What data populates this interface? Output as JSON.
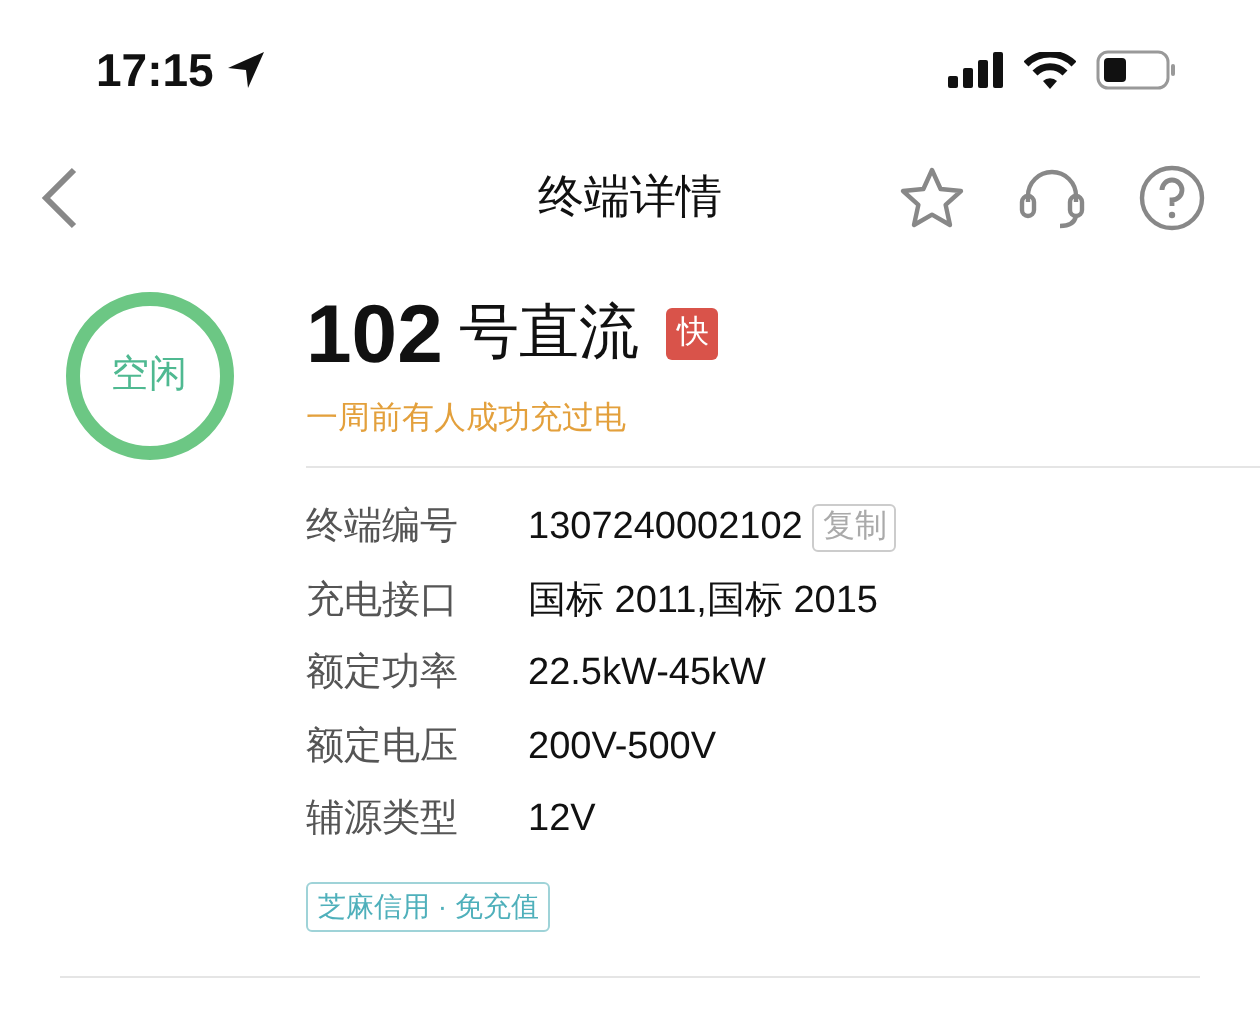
{
  "status_bar": {
    "time": "17:15"
  },
  "nav": {
    "title": "终端详情"
  },
  "terminal": {
    "status": "空闲",
    "number": "102",
    "type": "号直流",
    "badge": "快",
    "note": "一周前有人成功充过电",
    "fields": [
      {
        "label": "终端编号",
        "value": "1307240002102",
        "action": "复制"
      },
      {
        "label": "充电接口",
        "value": "国标 2011,国标 2015"
      },
      {
        "label": "额定功率",
        "value": "22.5kW-45kW"
      },
      {
        "label": "额定电压",
        "value": "200V-500V"
      },
      {
        "label": "辅源类型",
        "value": "12V"
      }
    ],
    "tag": "芝麻信用 · 免充值"
  }
}
